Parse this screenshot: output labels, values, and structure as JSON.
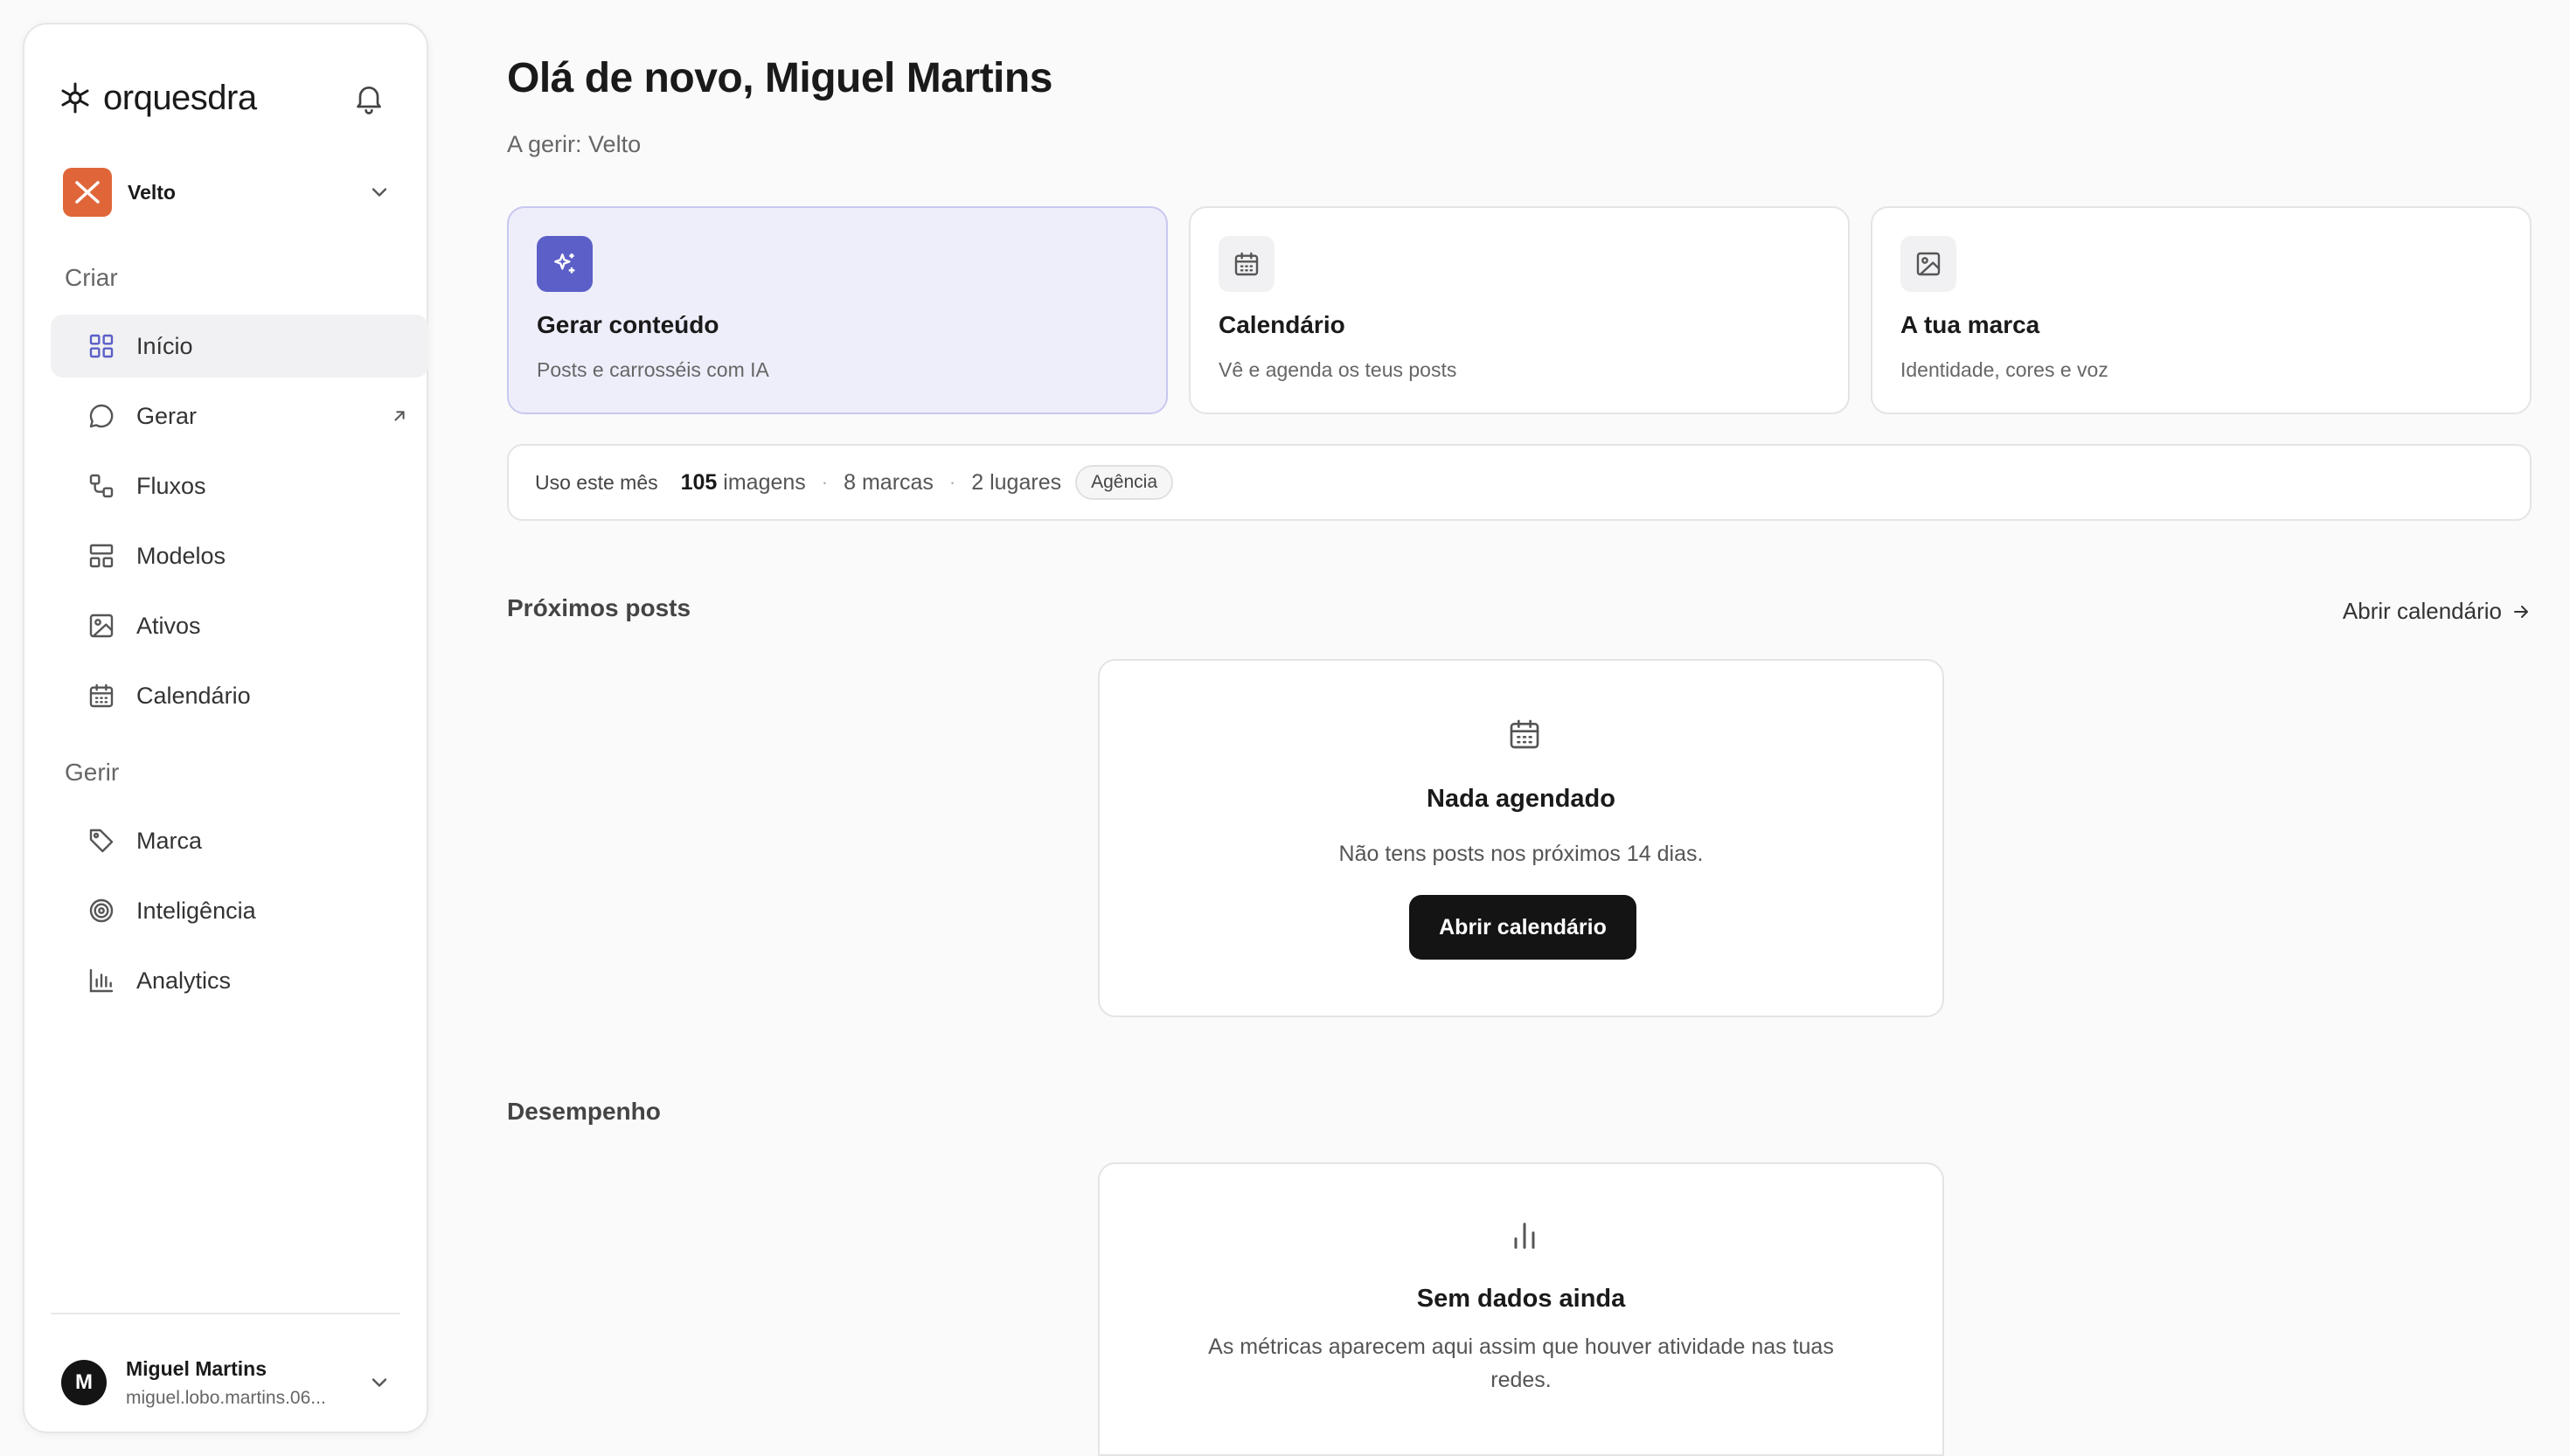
{
  "sidebar": {
    "logo_text": "orquesdra",
    "brand": {
      "name": "Velto",
      "color": "#e0663a"
    },
    "sections": {
      "create_label": "Criar",
      "manage_label": "Gerir"
    },
    "create_items": [
      {
        "label": "Início",
        "icon": "grid-icon",
        "active": true
      },
      {
        "label": "Gerar",
        "icon": "chat-bubble-icon",
        "external": true
      },
      {
        "label": "Fluxos",
        "icon": "flow-icon"
      },
      {
        "label": "Modelos",
        "icon": "template-layout-icon"
      },
      {
        "label": "Ativos",
        "icon": "image-icon"
      },
      {
        "label": "Calendário",
        "icon": "calendar-icon"
      }
    ],
    "manage_items": [
      {
        "label": "Marca",
        "icon": "tag-icon"
      },
      {
        "label": "Inteligência",
        "icon": "target-icon"
      },
      {
        "label": "Analytics",
        "icon": "bar-chart-icon"
      }
    ],
    "user": {
      "initial": "M",
      "name": "Miguel Martins",
      "email": "miguel.lobo.martins.06..."
    }
  },
  "main": {
    "title": "Olá de novo, Miguel Martins",
    "subtitle": "A gerir: Velto",
    "accent_color": "#5b5fc7",
    "quick_actions": [
      {
        "title": "Gerar conteúdo",
        "description": "Posts e carrosséis com IA",
        "icon": "sparkles-icon"
      },
      {
        "title": "Calendário",
        "description": "Vê e agenda os teus posts",
        "icon": "calendar-icon"
      },
      {
        "title": "A tua marca",
        "description": "Identidade, cores e voz",
        "icon": "image-icon"
      }
    ],
    "usage": {
      "label": "Uso este mês",
      "images_count": "105",
      "images_unit": "imagens",
      "brands": "8 marcas",
      "seats": "2 lugares",
      "plan": "Agência",
      "separator": "·"
    },
    "upcoming": {
      "title": "Próximos posts",
      "link_label": "Abrir calendário",
      "empty_title": "Nada agendado",
      "empty_text": "Não tens posts nos próximos 14 dias.",
      "button_label": "Abrir calendário"
    },
    "performance": {
      "title": "Desempenho",
      "empty_title": "Sem dados ainda",
      "empty_text": "As métricas aparecem aqui assim que houver atividade nas tuas redes."
    }
  }
}
